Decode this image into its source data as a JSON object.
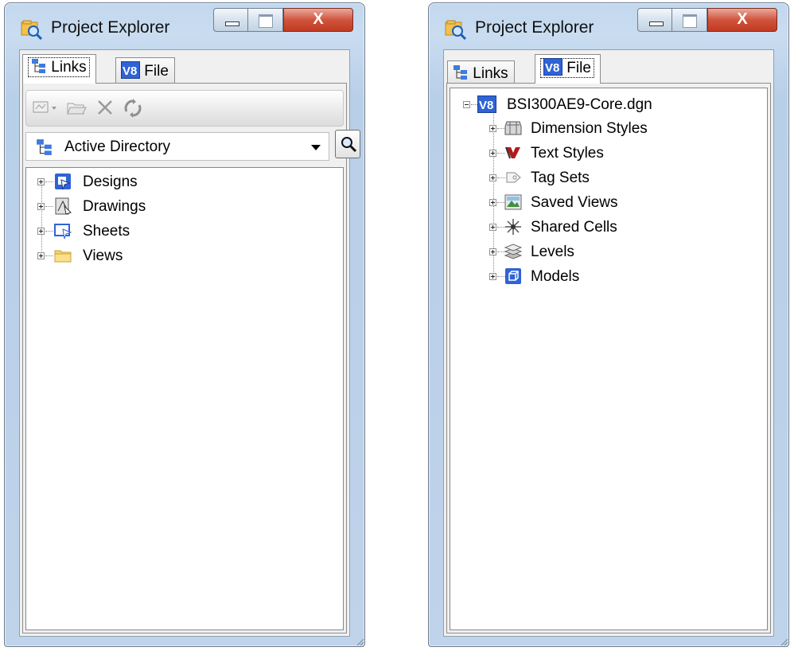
{
  "left_window": {
    "title": "Project Explorer",
    "close_label": "X",
    "tabs": [
      {
        "label": "Links",
        "icon": "links-tree-icon",
        "active": true
      },
      {
        "label": "File",
        "icon": "v8-file-icon",
        "active": false
      }
    ],
    "toolbar": [
      "link-set-dropdown-icon",
      "open-folder-icon",
      "delete-icon",
      "refresh-icon"
    ],
    "directory_select": {
      "value": "Active Directory",
      "icon": "links-tree-icon"
    },
    "tree": [
      {
        "label": "Designs",
        "icon": "designs-icon"
      },
      {
        "label": "Drawings",
        "icon": "drawings-icon"
      },
      {
        "label": "Sheets",
        "icon": "sheets-icon"
      },
      {
        "label": "Views",
        "icon": "folder-icon"
      }
    ]
  },
  "right_window": {
    "title": "Project Explorer",
    "close_label": "X",
    "tabs": [
      {
        "label": "Links",
        "icon": "links-tree-icon",
        "active": false
      },
      {
        "label": "File",
        "icon": "v8-file-icon",
        "active": true
      }
    ],
    "tree": {
      "root": {
        "label": "BSI300AE9-Core.dgn",
        "icon": "v8-file-icon"
      },
      "children": [
        {
          "label": "Dimension Styles",
          "icon": "dimension-styles-icon"
        },
        {
          "label": "Text Styles",
          "icon": "text-styles-icon"
        },
        {
          "label": "Tag Sets",
          "icon": "tag-sets-icon"
        },
        {
          "label": "Saved Views",
          "icon": "saved-views-icon"
        },
        {
          "label": "Shared Cells",
          "icon": "shared-cells-icon"
        },
        {
          "label": "Levels",
          "icon": "levels-icon"
        },
        {
          "label": "Models",
          "icon": "models-icon"
        }
      ]
    }
  },
  "colors": {
    "frame": "#c3d8ee",
    "close_button": "#c7412a",
    "v8_blue": "#2f63d6",
    "folder_yellow": "#f5d46a"
  }
}
